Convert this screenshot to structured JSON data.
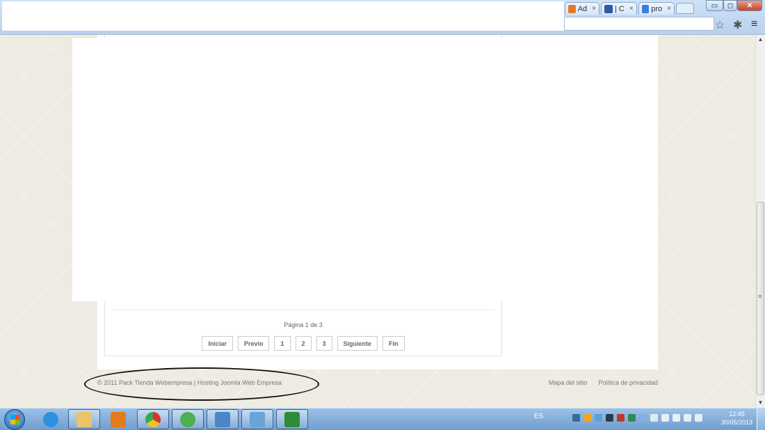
{
  "browser": {
    "tabs": [
      {
        "label": "Ad",
        "close": "×",
        "color": "#e07a2a"
      },
      {
        "label": "| C",
        "close": "×",
        "color": "#2a5aa8"
      },
      {
        "label": "pro",
        "close": "×",
        "color": "#3b7de0"
      }
    ],
    "window_buttons": {
      "minimize": "▭",
      "maximize": "◻",
      "close": "✕"
    },
    "toolbar": {
      "star_icon": "☆",
      "extension_icon": "✱",
      "menu_icon": "≡"
    }
  },
  "page": {
    "pagination_info": "Página 1 de 3",
    "pager": [
      "Iniciar",
      "Previo",
      "1",
      "2",
      "3",
      "Siguiente",
      "Fin"
    ],
    "footer": {
      "copyright": "© 2011 Pack Tienda Webempresa | Hosting Joomla Web Empresa",
      "links": [
        "Mapa del sitio",
        "Política de privacidad"
      ]
    }
  },
  "scrollbar": {
    "up": "▲",
    "down": "▼",
    "grip": "≡"
  },
  "taskbar": {
    "apps": [
      {
        "name": "internet-explorer-icon",
        "color": "#2f8fe0"
      },
      {
        "name": "file-explorer-icon",
        "color": "#e8c46a"
      },
      {
        "name": "media-player-icon",
        "color": "#e47a1e"
      },
      {
        "name": "chrome-icon",
        "color": "#d9342b"
      },
      {
        "name": "messenger-icon",
        "color": "#4caf50"
      },
      {
        "name": "image-viewer-icon",
        "color": "#4a86c8"
      },
      {
        "name": "notes-icon",
        "color": "#6aa3d6"
      },
      {
        "name": "excel-icon",
        "color": "#2e8b3a"
      }
    ],
    "language": "ES",
    "time": "12:45",
    "date": "30/05/2013"
  }
}
